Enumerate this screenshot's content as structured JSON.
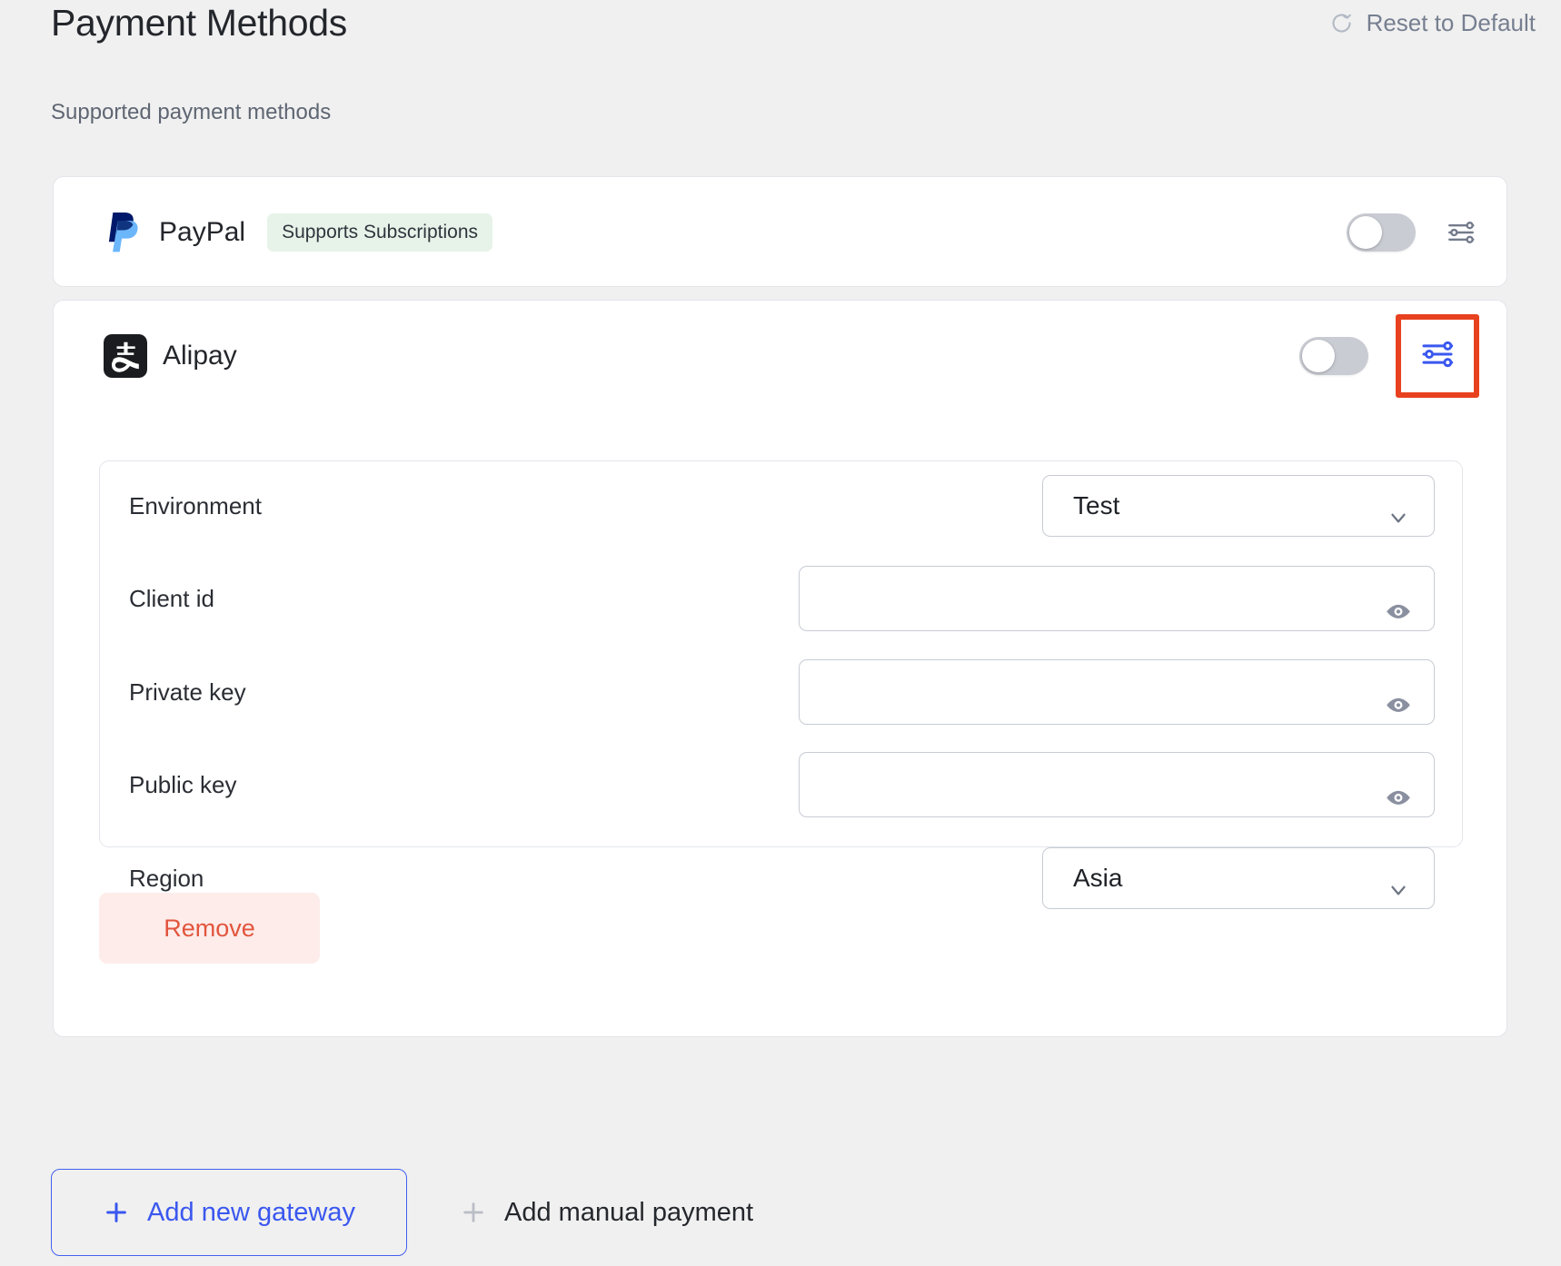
{
  "header": {
    "title": "Payment Methods",
    "reset_label": "Reset to Default",
    "reset_icon": "refresh-icon"
  },
  "section": {
    "subtitle": "Supported payment methods"
  },
  "gateways": [
    {
      "id": "paypal",
      "name": "PayPal",
      "logo_icon": "paypal-logo-icon",
      "badge": "Supports Subscriptions",
      "enabled": false,
      "toggle_state": "off",
      "settings_icon": "sliders-icon",
      "settings_highlighted": false,
      "expanded": false
    },
    {
      "id": "alipay",
      "name": "Alipay",
      "logo_icon": "alipay-logo-icon",
      "badge": null,
      "enabled": false,
      "toggle_state": "off",
      "settings_icon": "sliders-icon",
      "settings_highlighted": true,
      "expanded": true,
      "fields": [
        {
          "label": "Environment",
          "type": "select",
          "value": "Test",
          "icon": "chevron-down-icon"
        },
        {
          "label": "Client id",
          "type": "password",
          "value": "",
          "placeholder": "",
          "icon": "eye-icon"
        },
        {
          "label": "Private key",
          "type": "password",
          "value": "",
          "placeholder": "",
          "icon": "eye-icon"
        },
        {
          "label": "Public key",
          "type": "password",
          "value": "",
          "placeholder": "",
          "icon": "eye-icon"
        },
        {
          "label": "Region",
          "type": "select",
          "value": "Asia",
          "icon": "chevron-down-icon"
        }
      ],
      "remove_label": "Remove"
    }
  ],
  "footer": {
    "add_gateway_label": "Add new gateway",
    "add_gateway_icon": "plus-icon",
    "add_manual_label": "Add manual payment",
    "add_manual_icon": "plus-icon"
  },
  "colors": {
    "page_bg": "#f0f0f0",
    "card_bg": "#ffffff",
    "card_border": "#e3e5ea",
    "title": "#23262b",
    "muted": "#5f6673",
    "badge_bg": "#e7f3e9",
    "toggle_off": "#c9ccd3",
    "accent_blue": "#3a57ef",
    "highlight_red": "#e8411f",
    "remove_bg": "#fdecea",
    "remove_text": "#e2553d",
    "field_border": "#c7cbd3",
    "eye_icon": "#8b90a0"
  }
}
